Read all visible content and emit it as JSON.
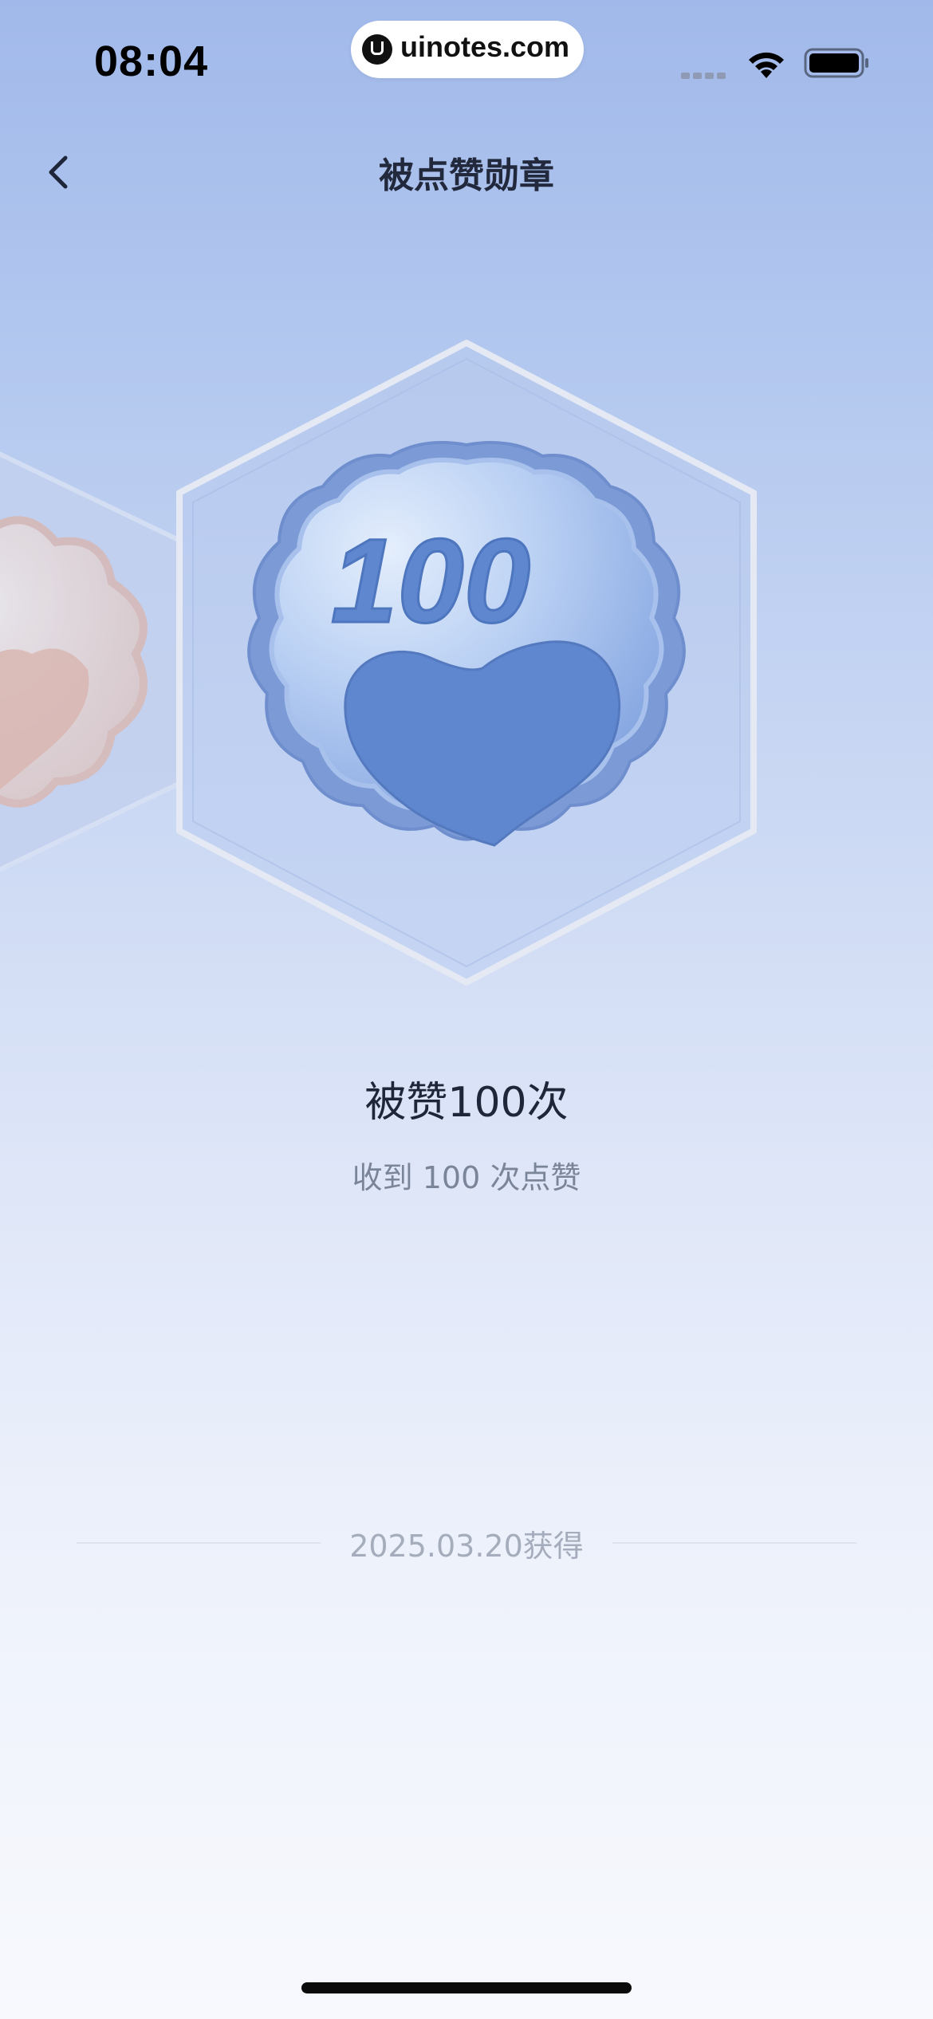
{
  "status_bar": {
    "time": "08:04",
    "url": "uinotes.com",
    "wifi_icon": "wifi-icon",
    "battery_icon": "battery-full-icon"
  },
  "nav": {
    "title": "被点赞勋章",
    "back_icon": "chevron-left-icon"
  },
  "badge": {
    "number": "100",
    "name": "被赞100次",
    "description": "收到 100 次点赞",
    "earned_date": "2025.03.20获得",
    "heart_icon": "heart-icon",
    "colors": {
      "primary_blue": "#5e87cf",
      "badge_light": "#cfe0f8",
      "neighbor_peach": "#e0c0b8"
    }
  }
}
